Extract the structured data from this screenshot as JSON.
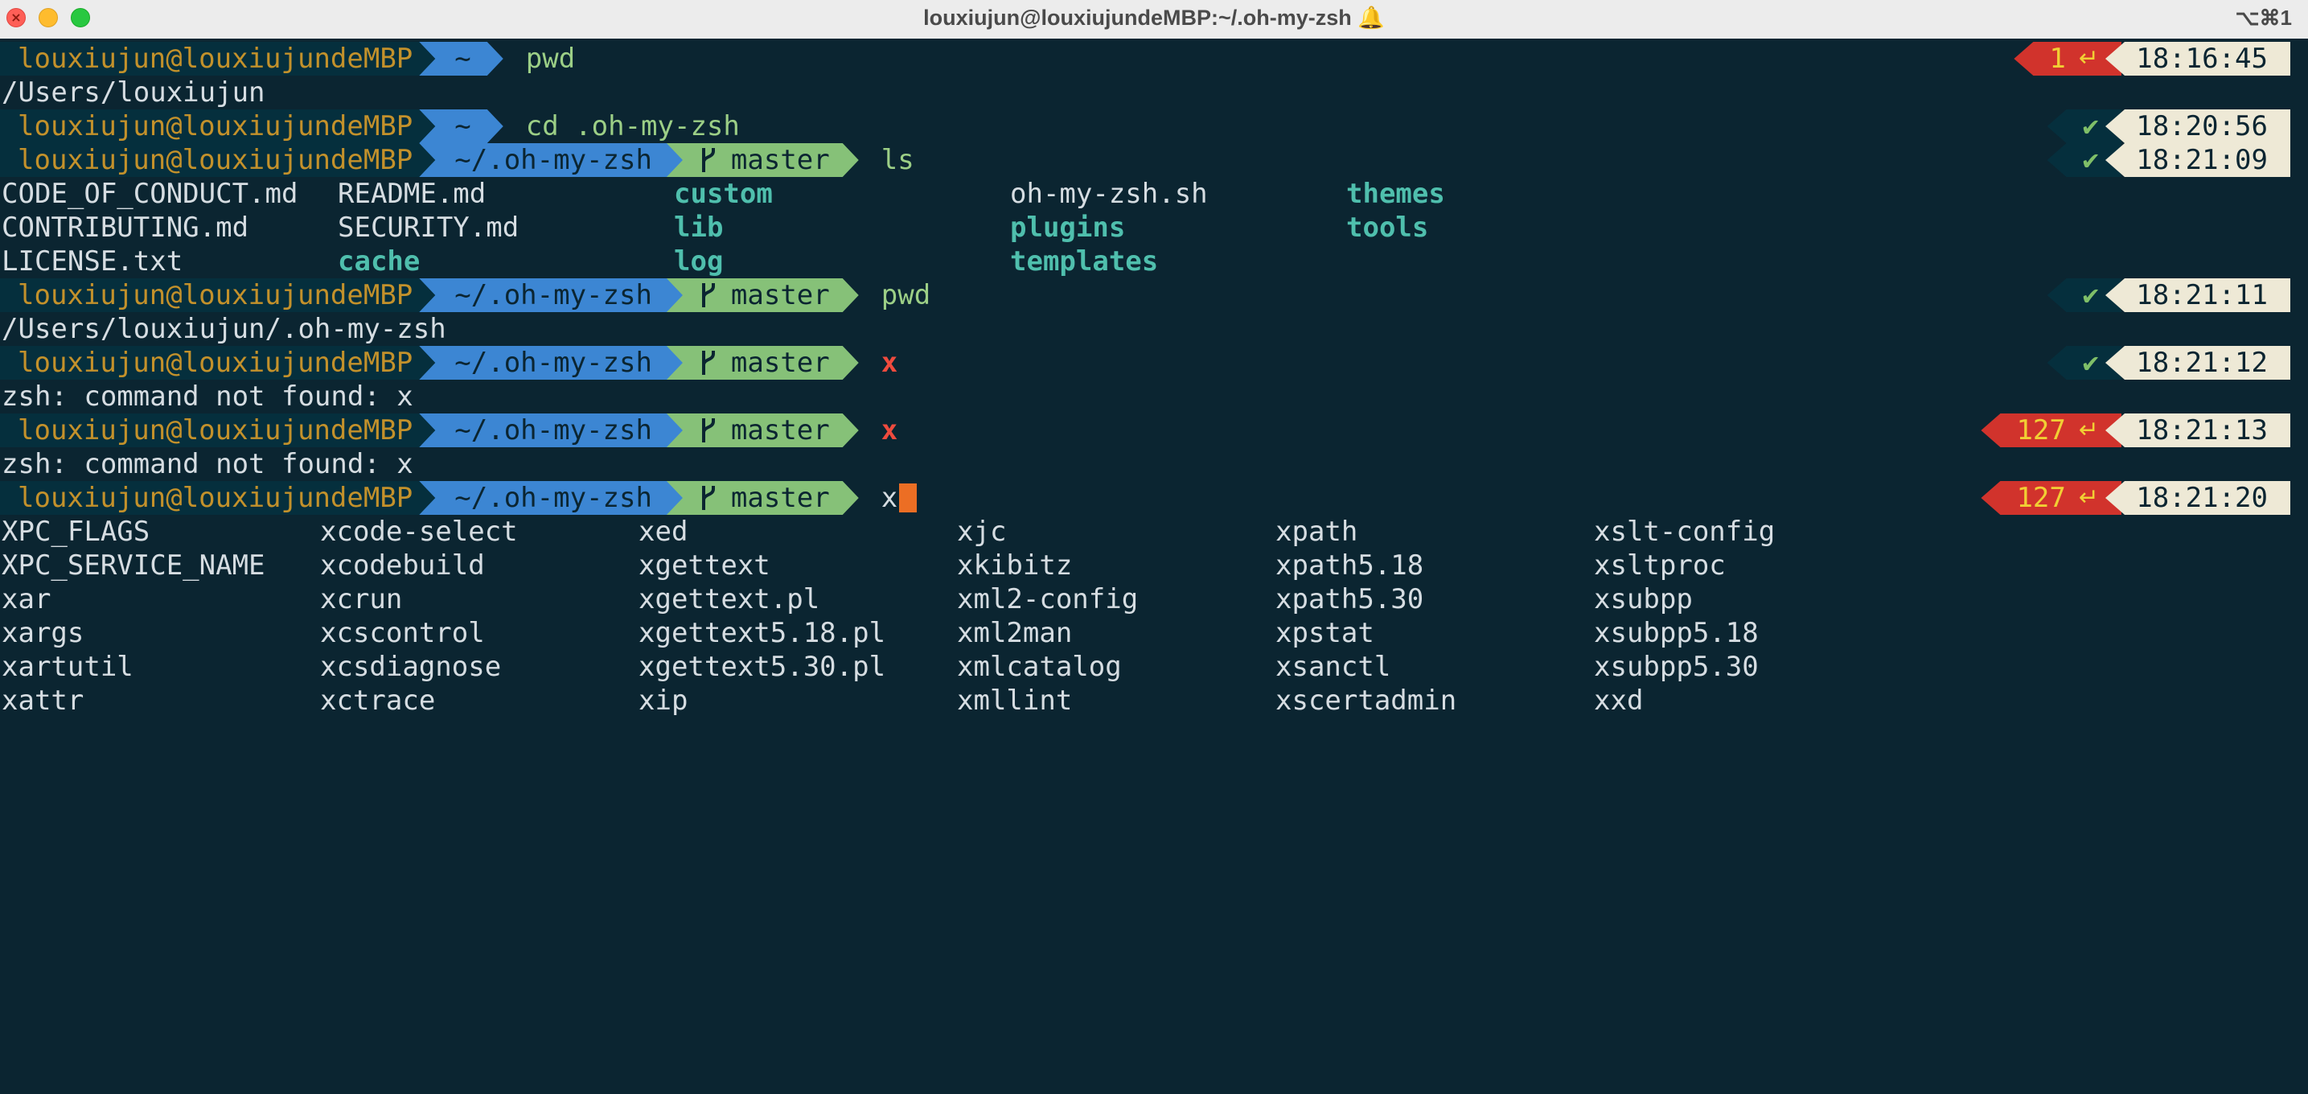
{
  "window": {
    "title": "louxiujun@louxiujundeMBP:~/.oh-my-zsh 🔔",
    "shortcut": "⌥⌘1"
  },
  "colors": {
    "background": "#0b2531",
    "context_fg": "#c3912b",
    "dir_bg": "#3c86d3",
    "git_bg": "#86c178",
    "error_bg": "#d1332c",
    "ok_fg": "#7fbf68",
    "time_bg": "#eee9d6",
    "dir_listing": "#4fbfad"
  },
  "prompt": {
    "context": "louxiujun@louxiujundeMBP",
    "home_dir": "~",
    "omz_dir": "~/.oh-my-zsh",
    "branch": "master",
    "branch_icon": "git-branch-icon",
    "enter_symbol": "↵",
    "check_symbol": "✔"
  },
  "session": [
    {
      "type": "prompt",
      "dir": "~",
      "git": false,
      "command": "pwd",
      "command_state": "ok",
      "status": "1",
      "status_kind": "error",
      "time": "18:16:45"
    },
    {
      "type": "output",
      "text": "/Users/louxiujun"
    },
    {
      "type": "prompt",
      "dir": "~",
      "git": false,
      "command": "cd .oh-my-zsh",
      "command_state": "ok",
      "status": "✔",
      "status_kind": "ok",
      "time": "18:20:56"
    },
    {
      "type": "prompt",
      "dir": "~/.oh-my-zsh",
      "git": true,
      "command": "ls",
      "command_state": "ok",
      "status": "✔",
      "status_kind": "ok",
      "time": "18:21:09"
    },
    {
      "type": "ls",
      "rows": [
        [
          {
            "name": "CODE_OF_CONDUCT.md",
            "kind": "file"
          },
          {
            "name": "README.md",
            "kind": "file"
          },
          {
            "name": "custom",
            "kind": "dir"
          },
          {
            "name": "oh-my-zsh.sh",
            "kind": "file"
          },
          {
            "name": "themes",
            "kind": "dir"
          }
        ],
        [
          {
            "name": "CONTRIBUTING.md",
            "kind": "file"
          },
          {
            "name": "SECURITY.md",
            "kind": "file"
          },
          {
            "name": "lib",
            "kind": "dir"
          },
          {
            "name": "plugins",
            "kind": "dir"
          },
          {
            "name": "tools",
            "kind": "dir"
          }
        ],
        [
          {
            "name": "LICENSE.txt",
            "kind": "file"
          },
          {
            "name": "cache",
            "kind": "dir"
          },
          {
            "name": "log",
            "kind": "dir"
          },
          {
            "name": "templates",
            "kind": "dir"
          }
        ]
      ]
    },
    {
      "type": "prompt",
      "dir": "~/.oh-my-zsh",
      "git": true,
      "command": "pwd",
      "command_state": "ok",
      "status": "✔",
      "status_kind": "ok",
      "time": "18:21:11"
    },
    {
      "type": "output",
      "text": "/Users/louxiujun/.oh-my-zsh"
    },
    {
      "type": "prompt",
      "dir": "~/.oh-my-zsh",
      "git": true,
      "command": "x",
      "command_state": "bad",
      "status": "✔",
      "status_kind": "ok",
      "time": "18:21:12"
    },
    {
      "type": "output",
      "text": "zsh: command not found: x"
    },
    {
      "type": "prompt",
      "dir": "~/.oh-my-zsh",
      "git": true,
      "command": "x",
      "command_state": "bad",
      "status": "127",
      "status_kind": "error",
      "time": "18:21:13"
    },
    {
      "type": "output",
      "text": "zsh: command not found: x"
    },
    {
      "type": "prompt",
      "dir": "~/.oh-my-zsh",
      "git": true,
      "command": "x",
      "command_state": "typing",
      "cursor": true,
      "status": "127",
      "status_kind": "error",
      "time": "18:21:20"
    }
  ],
  "completions": [
    [
      "XPC_FLAGS",
      "xcode-select",
      "xed",
      "xjc",
      "xpath",
      "xslt-config"
    ],
    [
      "XPC_SERVICE_NAME",
      "xcodebuild",
      "xgettext",
      "xkibitz",
      "xpath5.18",
      "xsltproc"
    ],
    [
      "xar",
      "xcrun",
      "xgettext.pl",
      "xml2-config",
      "xpath5.30",
      "xsubpp"
    ],
    [
      "xargs",
      "xcscontrol",
      "xgettext5.18.pl",
      "xml2man",
      "xpstat",
      "xsubpp5.18"
    ],
    [
      "xartutil",
      "xcsdiagnose",
      "xgettext5.30.pl",
      "xmlcatalog",
      "xsanctl",
      "xsubpp5.30"
    ],
    [
      "xattr",
      "xctrace",
      "xip",
      "xmllint",
      "xscertadmin",
      "xxd"
    ]
  ]
}
